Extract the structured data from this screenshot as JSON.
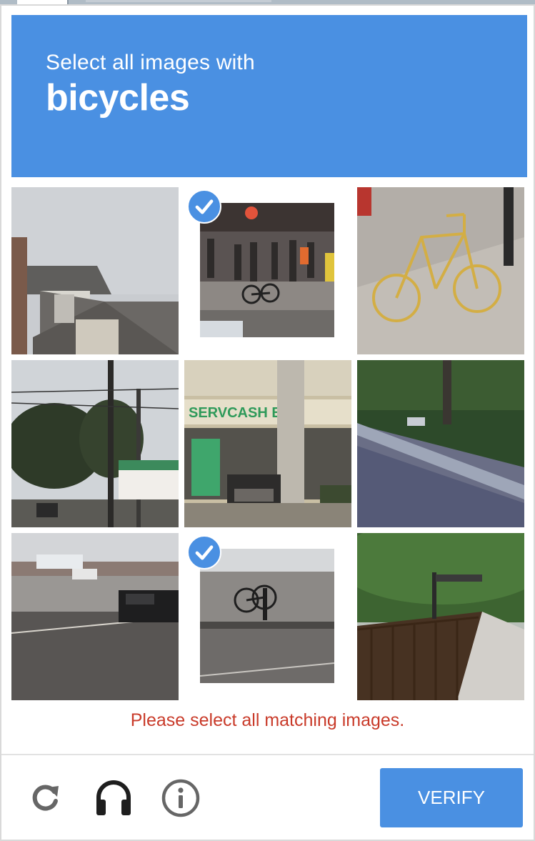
{
  "header": {
    "prompt": "Select all images with",
    "target": "bicycles",
    "color": "#4a90e2"
  },
  "tiles": [
    {
      "label": "tile-house-roof",
      "selected": false,
      "icon": ""
    },
    {
      "label": "tile-street-crowd-bicycle",
      "selected": true,
      "icon": "check-icon"
    },
    {
      "label": "tile-bicycle-rack-sculpture",
      "selected": false,
      "icon": ""
    },
    {
      "label": "tile-trees-power-lines",
      "selected": false,
      "icon": ""
    },
    {
      "label": "tile-storefront-car",
      "selected": false,
      "icon": ""
    },
    {
      "label": "tile-road-guardrail",
      "selected": false,
      "icon": ""
    },
    {
      "label": "tile-highway-car",
      "selected": false,
      "icon": ""
    },
    {
      "label": "tile-parked-bicycle",
      "selected": true,
      "icon": "check-icon"
    },
    {
      "label": "tile-hillside-bridge-railing",
      "selected": false,
      "icon": ""
    }
  ],
  "error_message": "Please select all matching images.",
  "error_color": "#c93b2a",
  "controls": {
    "reload_icon": "reload-icon",
    "audio_icon": "headphones-icon",
    "info_icon": "info-icon"
  },
  "verify_label": "VERIFY"
}
